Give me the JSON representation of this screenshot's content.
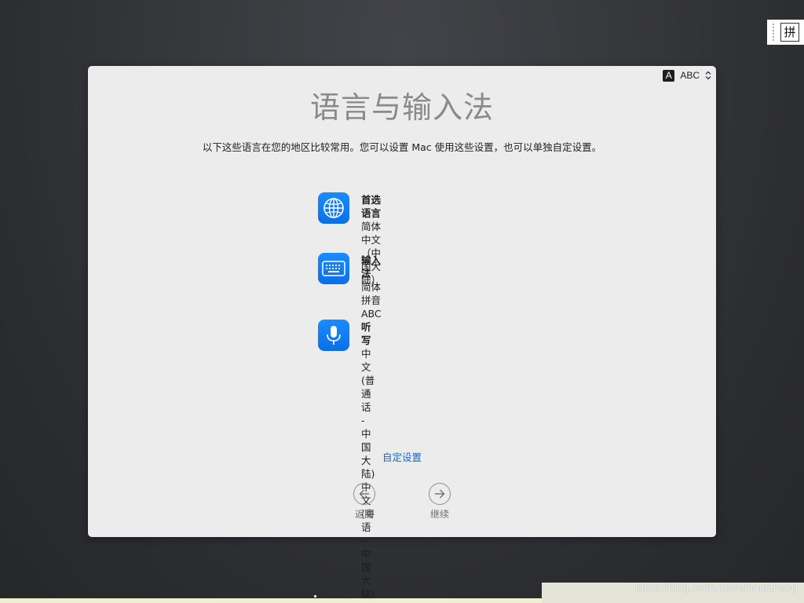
{
  "ime_indicator": {
    "glyph": "拼"
  },
  "panel": {
    "input_switcher": {
      "badge": "A",
      "label": "ABC"
    },
    "title": "语言与输入法",
    "subtitle": "以下这些语言在您的地区比较常用。您可以设置 Mac 使用这些设置，也可以单独自定设置。",
    "settings": [
      {
        "icon": "globe-icon",
        "title": "首选语言",
        "values": [
          "简体中文（中国大陆）"
        ]
      },
      {
        "icon": "keyboard-icon",
        "title": "输入法",
        "values": [
          "简体拼音",
          "ABC"
        ]
      },
      {
        "icon": "microphone-icon",
        "title": "听写",
        "values": [
          "中文 (普通话 - 中国大陆)",
          "中文 (粤语 - 中国大陆)"
        ]
      }
    ],
    "customize_link": "自定设置",
    "back_label": "返回",
    "continue_label": "继续"
  },
  "watermark": "https://blog.csdn.net/winniezhang",
  "colors": {
    "accent_blue": "#0a7af0",
    "link_blue": "#1767c8",
    "panel_bg": "#ececec",
    "title_gray": "#8a8a8a"
  }
}
